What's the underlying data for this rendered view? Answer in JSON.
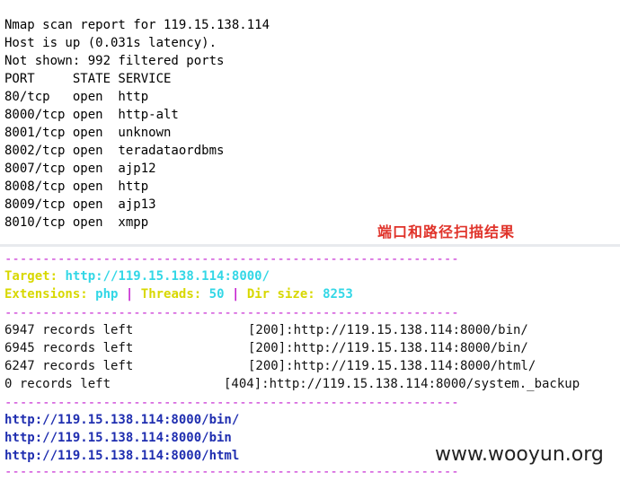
{
  "nmap": {
    "lines": [
      "Nmap scan report for 119.15.138.114",
      "Host is up (0.031s latency).",
      "Not shown: 992 filtered ports",
      "PORT     STATE SERVICE",
      "80/tcp   open  http",
      "8000/tcp open  http-alt",
      "8001/tcp open  unknown",
      "8002/tcp open  teradataordbms",
      "8007/tcp open  ajp12",
      "8008/tcp open  http",
      "8009/tcp open  ajp13",
      "8010/tcp open  xmpp"
    ]
  },
  "caption": "端口和路径扫描结果",
  "dirsearch": {
    "separator": "------------------------------------------------------------",
    "target_label": "Target:",
    "target_value": "http://119.15.138.114:8000/",
    "ext_label": "Extensions:",
    "ext_value": "php",
    "threads_label": "Threads:",
    "threads_value": "50",
    "dirsize_label": "Dir size:",
    "dirsize_value": "8253",
    "pipe": "|",
    "records": [
      {
        "left": "6947 records left",
        "result": "[200]:http://119.15.138.114:8000/bin/"
      },
      {
        "left": "6945 records left",
        "result": "[200]:http://119.15.138.114:8000/bin/"
      },
      {
        "left": "6247 records left",
        "result": "[200]:http://119.15.138.114:8000/html/"
      },
      {
        "left": "0 records left",
        "result": "[404]:http://119.15.138.114:8000/system._backup"
      }
    ],
    "found": [
      "http://119.15.138.114:8000/bin/",
      "http://119.15.138.114:8000/bin",
      "http://119.15.138.114:8000/html"
    ]
  },
  "watermark": "www.wooyun.org",
  "colors": {
    "caption": "#e0332a",
    "separator": "#c41fd0",
    "label_yellow": "#d8d800",
    "value_cyan": "#33d7e6",
    "url_blue": "#1f2eb0"
  }
}
